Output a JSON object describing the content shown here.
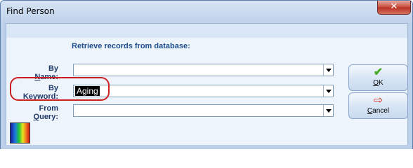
{
  "window": {
    "title": "Find Person",
    "close_glyph": "✕"
  },
  "form": {
    "caption": "Retrieve records from database:",
    "by_name": {
      "label_prefix": "By ",
      "label_accel": "N",
      "label_rest": "ame:",
      "value": ""
    },
    "by_keyword": {
      "label_prefix": "By ",
      "label_accel": "K",
      "label_rest": "eyword:",
      "value": "Aging"
    },
    "from_query": {
      "label_prefix": "From ",
      "label_accel": "Q",
      "label_rest": "uery:",
      "value": ""
    }
  },
  "buttons": {
    "ok": {
      "accel": "O",
      "rest": "K",
      "icon": "checkmark-icon"
    },
    "cancel": {
      "accel": "C",
      "rest": "ancel",
      "icon": "exit-arrow-icon"
    }
  },
  "colors": {
    "highlight_ring": "#cc1f1f",
    "ok_check": "#4aa82a",
    "cancel_icon": "#d2322a"
  }
}
